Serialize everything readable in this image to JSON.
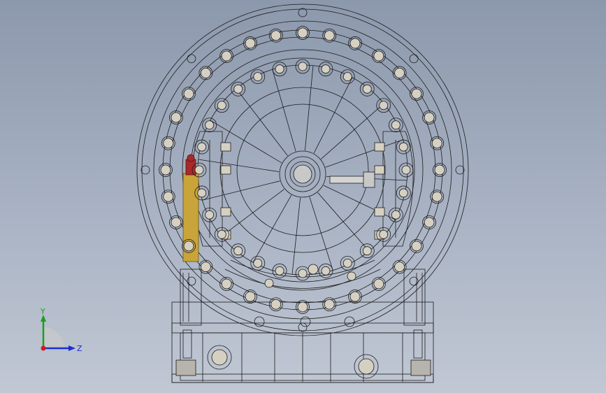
{
  "app": {
    "view": "front"
  },
  "triad": {
    "y_label": "Y",
    "z_label": "Z",
    "colors": {
      "y": "#1aa01a",
      "z": "#1a2fd0",
      "x": "#d01a1a"
    }
  },
  "model": {
    "line_color": "#1c1c1c",
    "bolt_fill": "#d6d0c2",
    "hub_fill": "#c8c8c8",
    "cylinder_fill": "#c9a43a",
    "cylinder_cap": "#a82a2a"
  }
}
